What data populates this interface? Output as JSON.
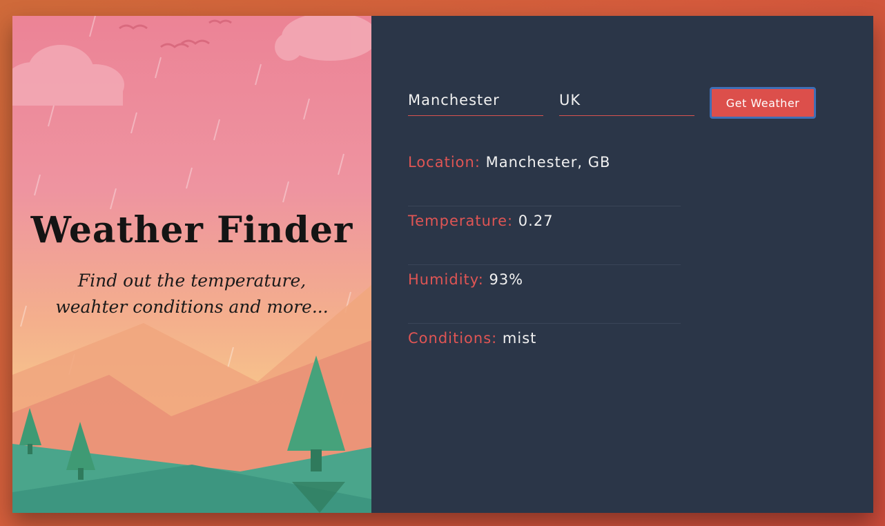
{
  "hero": {
    "title": "Weather Finder",
    "subtitle_line1": "Find out the temperature,",
    "subtitle_line2": "weahter conditions and more..."
  },
  "form": {
    "city_value": "Manchester",
    "country_value": "UK",
    "button_label": "Get Weather"
  },
  "results": {
    "location": {
      "label": "Location:",
      "value": "Manchester, GB"
    },
    "temperature": {
      "label": "Temperature:",
      "value": "0.27"
    },
    "humidity": {
      "label": "Humidity:",
      "value": "93%"
    },
    "conditions": {
      "label": "Conditions:",
      "value": "mist"
    }
  },
  "colors": {
    "panel": "#2b3648",
    "accent": "#dc4f4b",
    "button_focus_border": "#3f6fb5"
  }
}
